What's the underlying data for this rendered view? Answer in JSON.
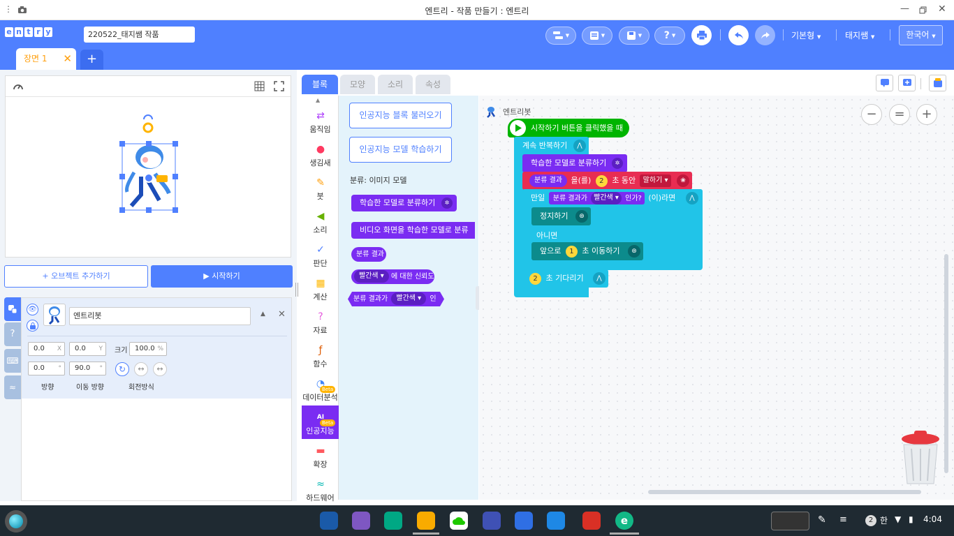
{
  "window": {
    "title": "엔트리 - 작품 만들기 : 엔트리"
  },
  "header": {
    "logo_letters": [
      "e",
      "n",
      "t",
      "r",
      "y"
    ],
    "project_name": "220522_태지쌤 작품",
    "mode": "기본형",
    "user": "태지쌤",
    "language": "한국어",
    "help_label": "?"
  },
  "scene": {
    "tab_label": "장면 1",
    "close": "✕",
    "add": "+"
  },
  "stage": {
    "add_object": "+ 오브젝트 추가하기",
    "start": "▶ 시작하기"
  },
  "object": {
    "name": "엔트리봇",
    "x": "0.0",
    "x_unit": "X",
    "y": "0.0",
    "y_unit": "Y",
    "size_label": "크기",
    "size": "100.0",
    "size_unit": "%",
    "direction": "0.0",
    "direction_unit": "°",
    "move_direction": "90.0",
    "move_direction_unit": "°",
    "direction_label": "방향",
    "move_direction_label": "이동 방향",
    "rotation_label": "회전방식"
  },
  "tabs": [
    "블록",
    "모양",
    "소리",
    "속성"
  ],
  "categories": [
    {
      "label": "움직임",
      "color": "#ad3efb",
      "glyph": "⇄"
    },
    {
      "label": "생김새",
      "color": "#ff3a61",
      "glyph": "●"
    },
    {
      "label": "붓",
      "color": "#ffa00f",
      "glyph": "✎"
    },
    {
      "label": "소리",
      "color": "#67b100",
      "glyph": "◀"
    },
    {
      "label": "판단",
      "color": "#4f80ff",
      "glyph": "✓"
    },
    {
      "label": "계산",
      "color": "#ffb700",
      "glyph": "▦"
    },
    {
      "label": "자료",
      "color": "#e457dc",
      "glyph": "?"
    },
    {
      "label": "함수",
      "color": "#de5c04",
      "glyph": "ƒ"
    },
    {
      "label": "데이터분석",
      "color": "#3e84fb",
      "glyph": "◔",
      "badge": "Beta"
    },
    {
      "label": "인공지능",
      "color": "#fff",
      "glyph": "AI",
      "badge": "Beta"
    },
    {
      "label": "확장",
      "color": "#ff5a5f",
      "glyph": "▬"
    },
    {
      "label": "하드웨어",
      "color": "#00b6b1",
      "glyph": "≈"
    }
  ],
  "palette": {
    "load_ai_blocks": "인공지능 블록 불러오기",
    "train_ai_model": "인공지능 모델 학습하기",
    "section_title": "분류: 이미지 모델",
    "blocks": {
      "classify": "학습한 모델로 분류하기",
      "video_classify": "비디오 화면을 학습한 모델로 분류",
      "result": "분류 결과",
      "color": "빨간색",
      "confidence": "에 대한 신뢰도",
      "result_is": "분류 결과가",
      "is_q": "인가?"
    }
  },
  "script": {
    "object_name": "엔트리봇",
    "when_start": "시작하기 버튼을 클릭했을 때",
    "repeat": "계속 반복하기",
    "classify": "학습한 모델로 분류하기",
    "say_chip": "분류 결과",
    "say_mid": "을(를)",
    "say_num": "2",
    "say_sec": "초 동안",
    "say_mode": "말하기",
    "if": "만일",
    "cond_result": "분류 결과가",
    "cond_color": "빨간색",
    "cond_q": "인가?",
    "if_end": "(이)라면",
    "stop": "정지하기",
    "else": "아니면",
    "move_pre": "앞으로",
    "move_num": "1",
    "move_post": "초 이동하기",
    "wait_num": "2",
    "wait_post": "초 기다리기"
  },
  "zoom": [
    "−",
    "=",
    "+"
  ],
  "taskbar": {
    "ime": "한",
    "time": "4:04",
    "notifications": "2"
  },
  "colors": {
    "accent": "#4f80ff",
    "start": "#00b400",
    "flow": "#21c4e8",
    "ai": "#7a2cf2",
    "looks": "#e82d52"
  }
}
